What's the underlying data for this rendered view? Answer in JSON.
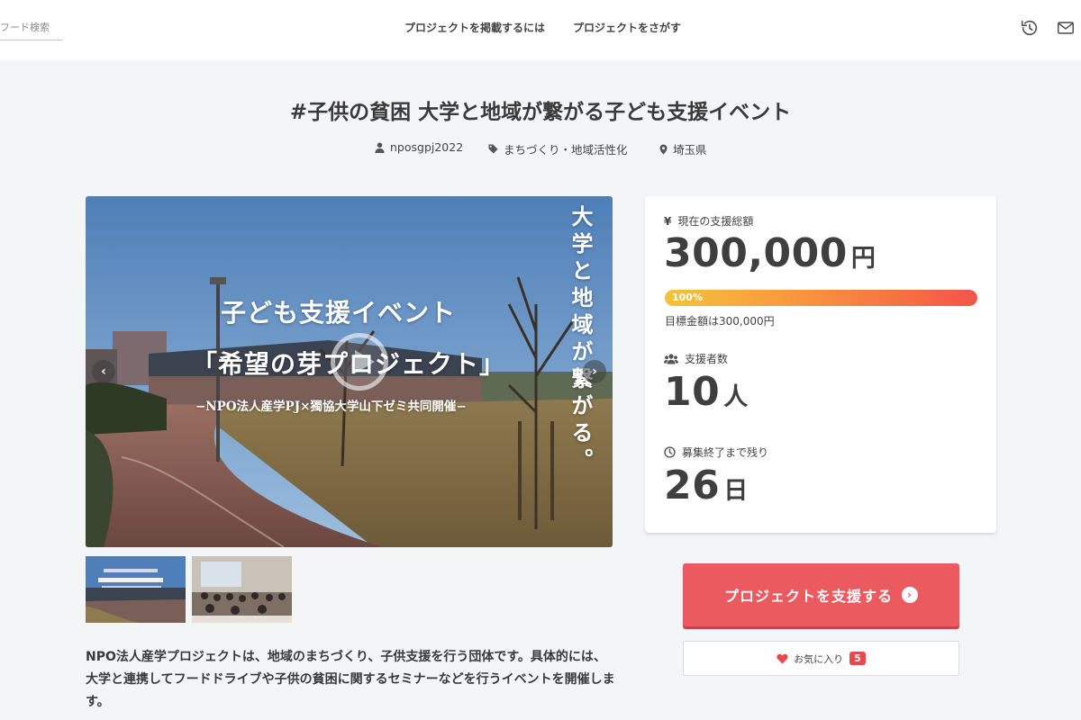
{
  "header": {
    "search_placeholder": "フード検索",
    "nav": [
      "プロジェクトを掲載するには",
      "プロジェクトをさがす"
    ]
  },
  "project": {
    "title": "#子供の貧困 大学と地域が繋がる子ども支援イベント",
    "owner": "nposgpj2022",
    "category": "まちづくり・地域活性化",
    "location": "埼玉県",
    "description": "NPO法人産学プロジェクトは、地域のまちづくり、子供支援を行う団体です。具体的には、大学と連携してフードドライブや子供の貧困に関するセミナーなどを行うイベントを開催します。"
  },
  "media": {
    "title_line1": "子ども支援イベント",
    "title_line2": "「希望の芽プロジェクト」",
    "subtitle": "−NPO法人産学PJ×獨協大学山下ゼミ共同開催−",
    "vertical_text": "大学と地域が繋がる。",
    "prev_label": "‹",
    "next_label": "›"
  },
  "stats": {
    "total_label": "現在の支援総額",
    "total_value": "300,000",
    "total_unit": "円",
    "progress_percent": 100,
    "progress_text": "100%",
    "goal_text": "目標金額は300,000円",
    "backers_label": "支援者数",
    "backers_value": "10",
    "backers_unit": "人",
    "remaining_label": "募集終了まで残り",
    "remaining_value": "26",
    "remaining_unit": "日"
  },
  "actions": {
    "support_label": "プロジェクトを支援する",
    "support_icon": "›",
    "favorite_label": "お気に入り",
    "favorite_count": "5"
  },
  "colors": {
    "accent": "#ea5a5f",
    "progress_start": "#f6c23a",
    "progress_end": "#f25548"
  }
}
